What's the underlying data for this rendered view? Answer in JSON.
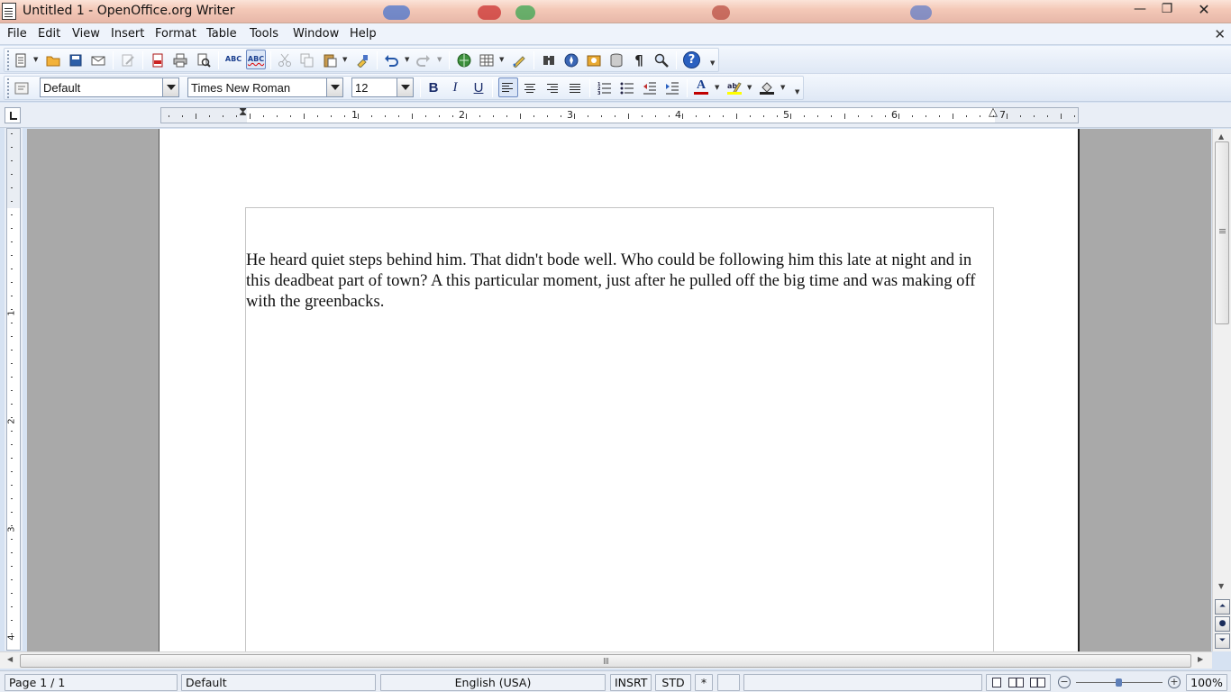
{
  "window": {
    "title": "Untitled 1 - OpenOffice.org Writer",
    "min_glyph": "—",
    "max_glyph": "❐",
    "close_glyph": "✕"
  },
  "menu": {
    "items": [
      {
        "label": "File"
      },
      {
        "label": "Edit"
      },
      {
        "label": "View"
      },
      {
        "label": "Insert"
      },
      {
        "label": "Format"
      },
      {
        "label": "Table"
      },
      {
        "label": "Tools"
      },
      {
        "label": "Window"
      },
      {
        "label": "Help"
      }
    ],
    "doc_close_glyph": "✕"
  },
  "standard_toolbar": {
    "icons": [
      "new-document-icon",
      "open-icon",
      "save-icon",
      "email-document-icon",
      "edit-file-icon",
      "export-pdf-icon",
      "print-icon",
      "page-preview-icon",
      "spellcheck-icon",
      "autospellcheck-icon",
      "cut-icon",
      "copy-icon",
      "paste-icon",
      "clone-formatting-icon",
      "undo-icon",
      "redo-icon",
      "hyperlink-icon",
      "table-icon",
      "show-draw-functions-icon",
      "find-replace-icon",
      "navigator-icon",
      "gallery-icon",
      "data-sources-icon",
      "nonprinting-characters-icon",
      "zoom-icon",
      "help-icon"
    ],
    "spellcheck_text": "ABC",
    "help_glyph": "?"
  },
  "formatting_toolbar": {
    "paragraph_style": "Default",
    "font_name": "Times New Roman",
    "font_size": "12",
    "bold_label": "B",
    "italic_label": "I",
    "underline_label": "U",
    "font_color": "#c00000",
    "highlight_color": "#ffff00"
  },
  "ruler": {
    "h_numbers": [
      "1",
      "2",
      "3",
      "4",
      "5",
      "6",
      "7"
    ],
    "v_numbers": [
      "1",
      "2",
      "3",
      "4"
    ]
  },
  "document": {
    "text": "He heard quiet steps behind him. That didn't bode well. Who could be following him this late at night and in this deadbeat part of town? A this particular moment, just after he pulled off the big time and was making off with the greenbacks."
  },
  "status": {
    "page": "Page 1 / 1",
    "style": "Default",
    "language": "English (USA)",
    "insert_mode": "INSRT",
    "selection_mode": "STD",
    "modified": "*",
    "zoom": "100%",
    "zoom_level_percent": 100
  },
  "colors": {
    "menu_bg": "#eef3fb",
    "toolbar_bg": "#e2eaf6",
    "workspace_gray": "#a9a9a9",
    "page_white": "#ffffff",
    "accent_blue": "#3b6fc4"
  }
}
